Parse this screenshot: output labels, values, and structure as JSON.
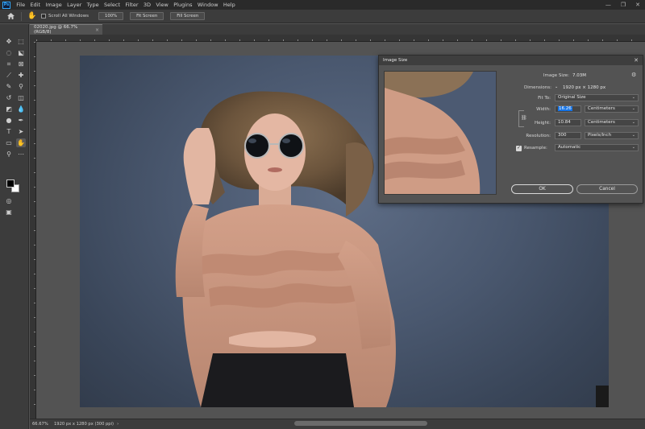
{
  "menubar": {
    "items": [
      "File",
      "Edit",
      "Image",
      "Layer",
      "Type",
      "Select",
      "Filter",
      "3D",
      "View",
      "Plugins",
      "Window",
      "Help"
    ],
    "logo_text": "Ps",
    "window_controls": [
      "—",
      "❐",
      "✕"
    ]
  },
  "options_bar": {
    "home_icon": "home-icon",
    "hand_icon": "hand-icon",
    "scroll_all_windows": "Scroll All Windows",
    "zoom_100": "100%",
    "fit_screen": "Fit Screen",
    "fill_screen": "Fill Screen"
  },
  "document": {
    "tab_title": "02020.jpg @ 66.7% (RGB/8)",
    "tab_close": "×"
  },
  "status_bar": {
    "zoom": "66.67%",
    "doc_info": "1920 px x 1280 px (300 ppi)",
    "arrow": "›"
  },
  "image_size_dialog": {
    "title": "Image Size",
    "close_glyph": "✕",
    "image_size_label": "Image Size:",
    "image_size_value": "7.03M",
    "dimensions_label": "Dimensions:",
    "dimensions_value": "1920 px  ×  1280 px",
    "fit_to_label": "Fit To:",
    "fit_to_value": "Original Size",
    "width_label": "Width:",
    "width_value": "16.26",
    "width_unit": "Centimeters",
    "height_label": "Height:",
    "height_value": "10.84",
    "height_unit": "Centimeters",
    "resolution_label": "Resolution:",
    "resolution_value": "300",
    "resolution_unit": "Pixels/Inch",
    "resample_label": "Resample:",
    "resample_value": "Automatic",
    "resample_checked": true,
    "ok_label": "OK",
    "cancel_label": "Cancel"
  },
  "colors": {
    "app_bg": "#535353",
    "menubar_bg": "#2a2a2a",
    "panel_bg": "#3c3c3c",
    "photo_bg": "#4a586f",
    "blouse": "#c9957e",
    "accent": "#1473e6"
  }
}
